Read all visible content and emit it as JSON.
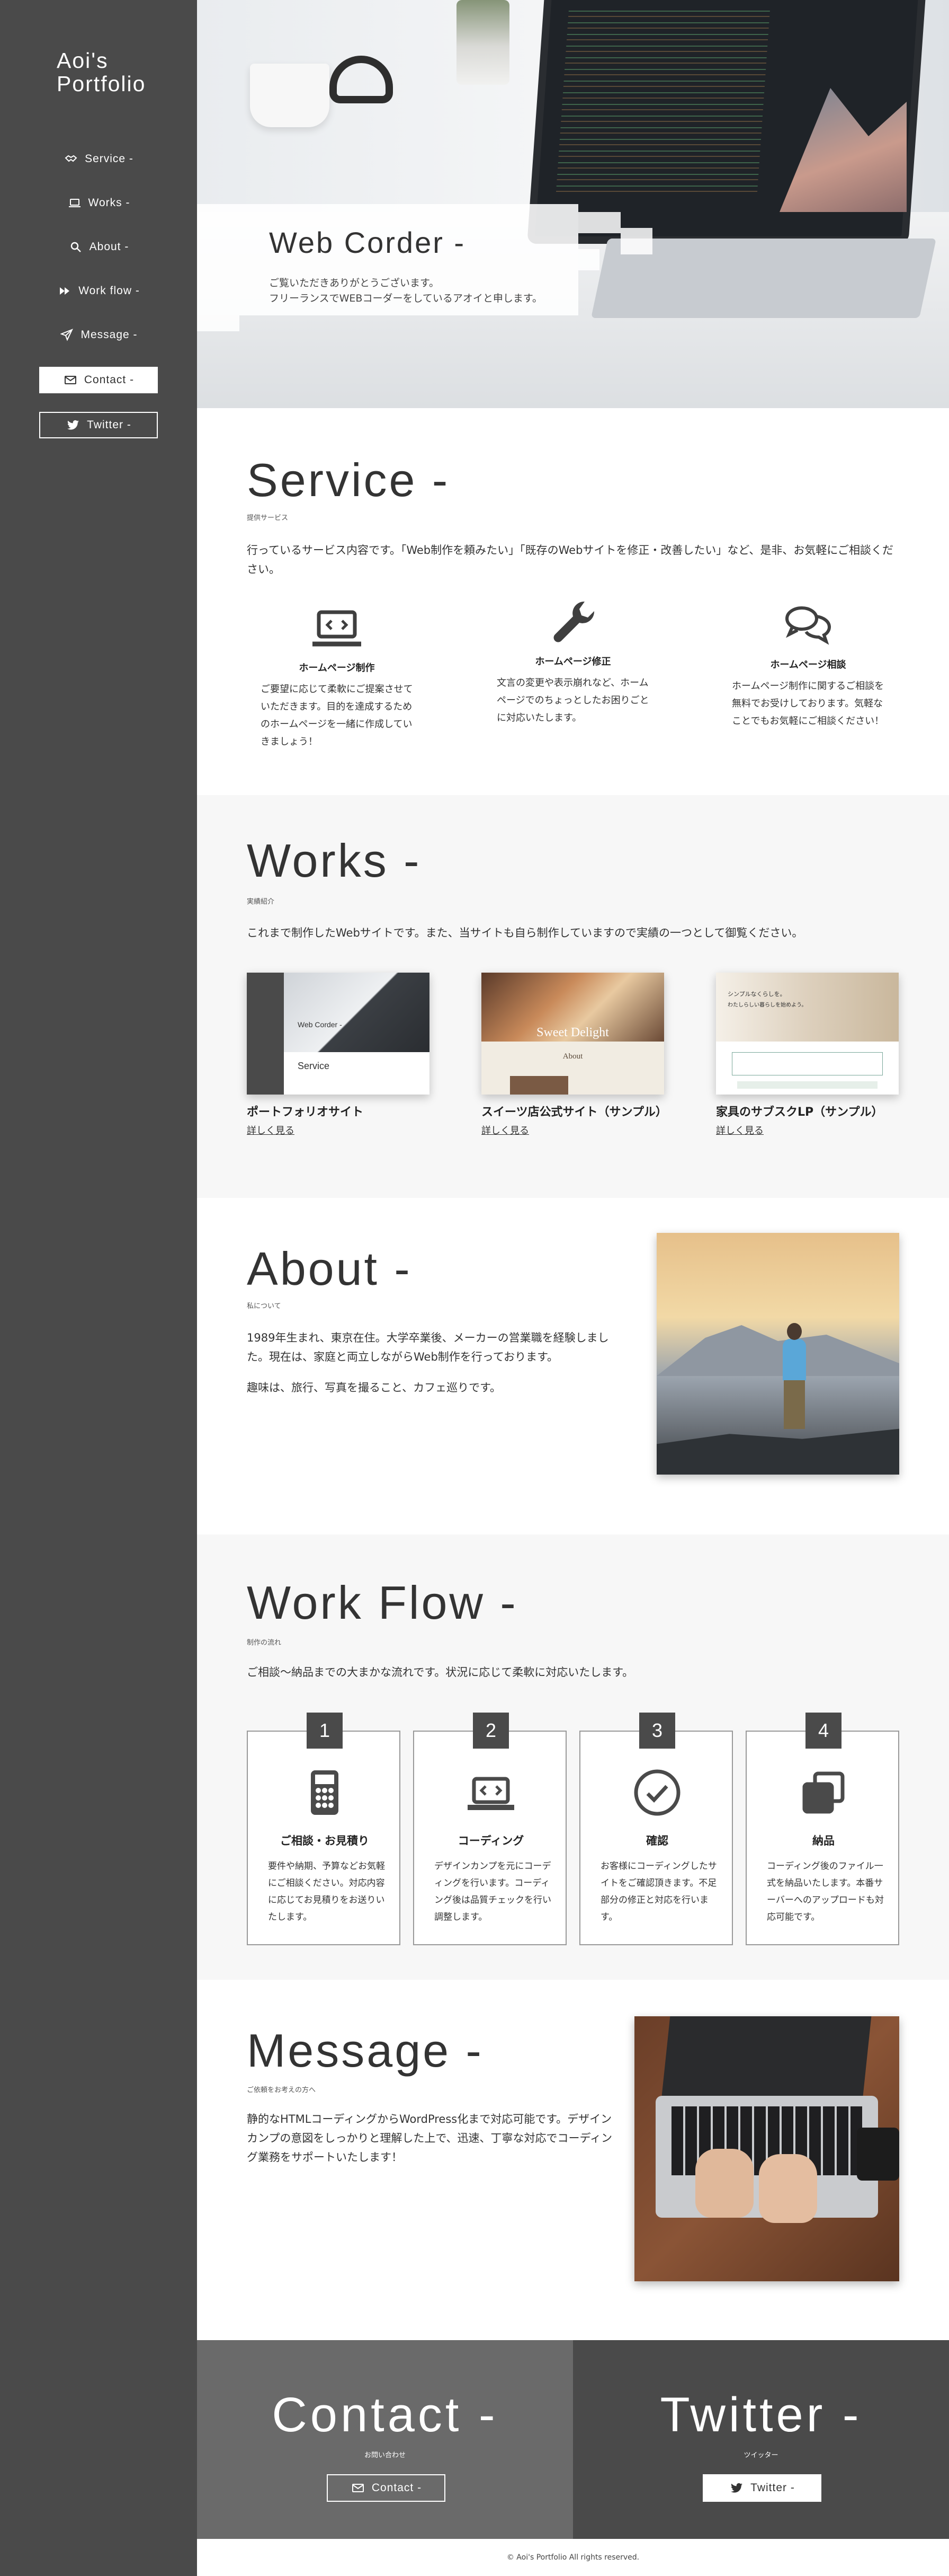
{
  "logo": "Aoi's\nPortfolio",
  "nav": [
    {
      "label": "Service -",
      "icon": "handshake-icon"
    },
    {
      "label": "Works -",
      "icon": "laptop-icon"
    },
    {
      "label": "About -",
      "icon": "search-icon"
    },
    {
      "label": "Work flow -",
      "icon": "fast-forward-icon"
    },
    {
      "label": "Message -",
      "icon": "paper-plane-icon"
    }
  ],
  "sidebar_buttons": {
    "contact": "Contact -",
    "twitter": "Twitter -"
  },
  "hero": {
    "title": "Web Corder -",
    "line1": "ご覧いただきありがとうございます。",
    "line2": "フリーランスでWEBコーダーをしているアオイと申します。"
  },
  "service": {
    "title": "Service -",
    "subtitle": "提供サービス",
    "lead": "行っているサービス内容です。「Web制作を頼みたい」「既存のWebサイトを修正・改善したい」など、是非、お気軽にご相談ください。",
    "items": [
      {
        "name": "ホームページ制作",
        "desc": "ご要望に応じて柔軟にご提案させていただきます。目的を達成するためのホームページを一緒に作成していきましょう！",
        "icon": "laptop-code-icon"
      },
      {
        "name": "ホームページ修正",
        "desc": "文言の変更や表示崩れなど、ホームページでのちょっとしたお困りごとに対応いたします。",
        "icon": "wrench-icon"
      },
      {
        "name": "ホームページ相談",
        "desc": "ホームページ制作に関するご相談を無料でお受けしております。気軽なことでもお気軽にご相談ください！",
        "icon": "comments-icon"
      }
    ]
  },
  "works": {
    "title": "Works -",
    "subtitle": "実績紹介",
    "lead": "これまで制作したWebサイトです。また、当サイトも自ら制作していますので実績の一つとして御覧ください。",
    "items": [
      {
        "title": "ポートフォリオサイト",
        "more": "詳しく見る",
        "thumb_caption": "Web Corder -",
        "thumb_caption2": "Service"
      },
      {
        "title": "スイーツ店公式サイト（サンプル）",
        "more": "詳しく見る",
        "thumb_caption": "Sweet Delight",
        "thumb_caption2": "About"
      },
      {
        "title": "家具のサブスクLP（サンプル）",
        "more": "詳しく見る",
        "thumb_caption": "シンプルなくらしを。",
        "thumb_caption2": "わたしらしい暮らしを始めよう。"
      }
    ]
  },
  "about": {
    "title": "About -",
    "subtitle": "私について",
    "p1": "1989年生まれ、東京在住。大学卒業後、メーカーの営業職を経験しました。現在は、家庭と両立しながらWeb制作を行っております。",
    "p2": "趣味は、旅行、写真を撮ること、カフェ巡りです。"
  },
  "workflow": {
    "title": "Work Flow -",
    "subtitle": "制作の流れ",
    "lead": "ご相談〜納品までの大まかな流れです。状況に応じて柔軟に対応いたします。",
    "steps": [
      {
        "num": "1",
        "name": "ご相談・お見積り",
        "desc": "要件や納期、予算などお気軽にご相談ください。対応内容に応じてお見積りをお送りいたします。",
        "icon": "calculator-icon"
      },
      {
        "num": "2",
        "name": "コーディング",
        "desc": "デザインカンプを元にコーディングを行います。コーディング後は品質チェックを行い調整します。",
        "icon": "laptop-code-icon"
      },
      {
        "num": "3",
        "name": "確認",
        "desc": "お客様にコーディングしたサイトをご確認頂きます。不足部分の修正と対応を行います。",
        "icon": "check-circle-icon"
      },
      {
        "num": "4",
        "name": "納品",
        "desc": "コーディング後のファイル一式を納品いたします。本番サーバーへのアップロードも対応可能です。",
        "icon": "copy-icon"
      }
    ]
  },
  "message": {
    "title": "Message -",
    "subtitle": "ご依頼をお考えの方へ",
    "text": "静的なHTMLコーディングからWordPress化まで対応可能です。デザインカンプの意図をしっかりと理解した上で、迅速、丁寧な対応でコーディング業務をサポートいたします！"
  },
  "cta": {
    "contact": {
      "big": "Contact -",
      "small": "お問い合わせ",
      "button": "Contact -"
    },
    "twitter": {
      "big": "Twitter -",
      "small": "ツイッター",
      "button": "Twitter -"
    }
  },
  "footer": "© Aoi's Portfolio All rights reserved.",
  "colors": {
    "sidebar": "#4a4a4a",
    "section_alt": "#f7f7f7",
    "cta_contact": "#6a6a6a",
    "cta_twitter": "#4a4a4a",
    "text": "#333333"
  }
}
